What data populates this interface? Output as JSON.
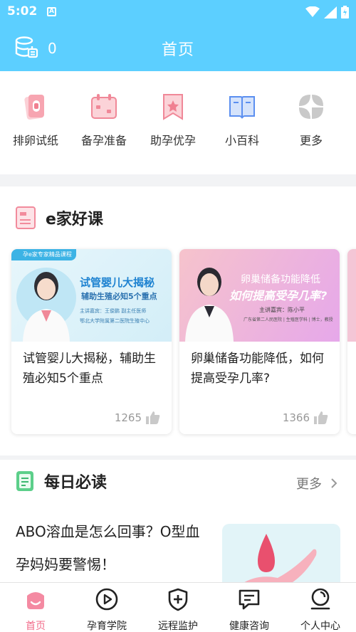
{
  "status": {
    "time": "5:02",
    "notif_icon": "A"
  },
  "header": {
    "title": "首页",
    "coin_count": "0",
    "coin_icon": "database-icon"
  },
  "quick_menu": [
    {
      "label": "排卵试纸",
      "icon": "test-strip-icon"
    },
    {
      "label": "备孕准备",
      "icon": "calendar-icon"
    },
    {
      "label": "助孕优孕",
      "icon": "bookmark-star-icon"
    },
    {
      "label": "小百科",
      "icon": "book-icon"
    },
    {
      "label": "更多",
      "icon": "grid-more-icon"
    }
  ],
  "courses": {
    "title": "e家好课",
    "items": [
      {
        "title": "试管婴儿大揭秘，辅助生殖必知5个重点",
        "likes": "1265",
        "thumb_tag": "孕e家专家精品课程",
        "thumb_heading": "试管婴儿大揭秘",
        "thumb_sub": "辅助生殖必知5个重点",
        "thumb_info1": "主讲嘉宾：王俊鹏  副主任医师",
        "thumb_info2": "鄂北大学附属第二医院生殖中心"
      },
      {
        "title": "卵巢储备功能降低，如何提高受孕几率?",
        "likes": "1366",
        "thumb_heading": "卵巢储备功能降低",
        "thumb_sub": "如何提高受孕几率?",
        "thumb_info1": "主讲嘉宾：陈小平",
        "thumb_info2": "广东省第二人民医院 | 生殖医学科 | 博士，教授"
      }
    ]
  },
  "daily": {
    "title": "每日必读",
    "more": "更多",
    "article_title": "ABO溶血是怎么回事？O型血孕妈妈要警惕！"
  },
  "tabs": [
    {
      "label": "首页",
      "icon": "home-icon",
      "active": true
    },
    {
      "label": "孕育学院",
      "icon": "play-circle-icon",
      "active": false
    },
    {
      "label": "远程监护",
      "icon": "shield-plus-icon",
      "active": false
    },
    {
      "label": "健康咨询",
      "icon": "chat-icon",
      "active": false
    },
    {
      "label": "个人中心",
      "icon": "profile-icon",
      "active": false
    }
  ],
  "colors": {
    "header_bg": "#5ccfff",
    "accent_pink": "#f26b8a",
    "blue_icon": "#5b8ff0"
  }
}
